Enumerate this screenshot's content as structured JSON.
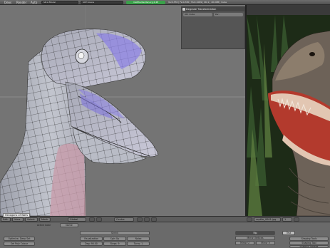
{
  "menu": [
    "Deos",
    "Render",
    "Auto"
  ],
  "header": {
    "screen_field": "SR:2-Model",
    "scene_field": "SCE:Scene",
    "url_badge": "mattherberder.org 2.48",
    "stats": "Ve:0-332 | Fa:0-330 | Fa:0-1099 | Ob:1 | 40.09M | Cube"
  },
  "transform_panel": {
    "title": "Degrade Transformation",
    "ob_field": "OB: Cube",
    "par_field": "Par:"
  },
  "viewport_header": {
    "floating_menu": "Hexagons of Walls",
    "mode_button": "Edit",
    "view_menu": "View",
    "select_menu": "Select",
    "mesh_menu": "Mesh",
    "shading_button": "Global",
    "pivot_button": "Centre"
  },
  "image_header": {
    "image_name": "reptile_0001.jpg",
    "image_name_extra": "1"
  },
  "buttons_panel": {
    "link_label": "Active Color",
    "name_field": "Name",
    "edit_block_title": "Shrink",
    "sub_tabs": [
      "Visualization",
      "Spin Op",
      "Noise"
    ],
    "sub_values": [
      "Deg: 90.00",
      "Steps: 9",
      "Turns: 1"
    ],
    "left_btn1": "Optimize, Deep Set",
    "left_btn2": "Set Poly Colour",
    "right_header": "Rip",
    "right_tab": "Test",
    "right_top": "Mirror Vertices",
    "mirror_u": "Mirror U",
    "mirror_v": "Mirror V",
    "right_buttons": [
      "Shaping Tools",
      "Shaping Tool",
      "Shaping Toolbox"
    ]
  },
  "colors": {
    "url_badge": "#3aa14a",
    "mesh_highlight": "#8a7fe6",
    "viewport_bg": "#747474",
    "mesh_shade": "#b9bcc6"
  }
}
